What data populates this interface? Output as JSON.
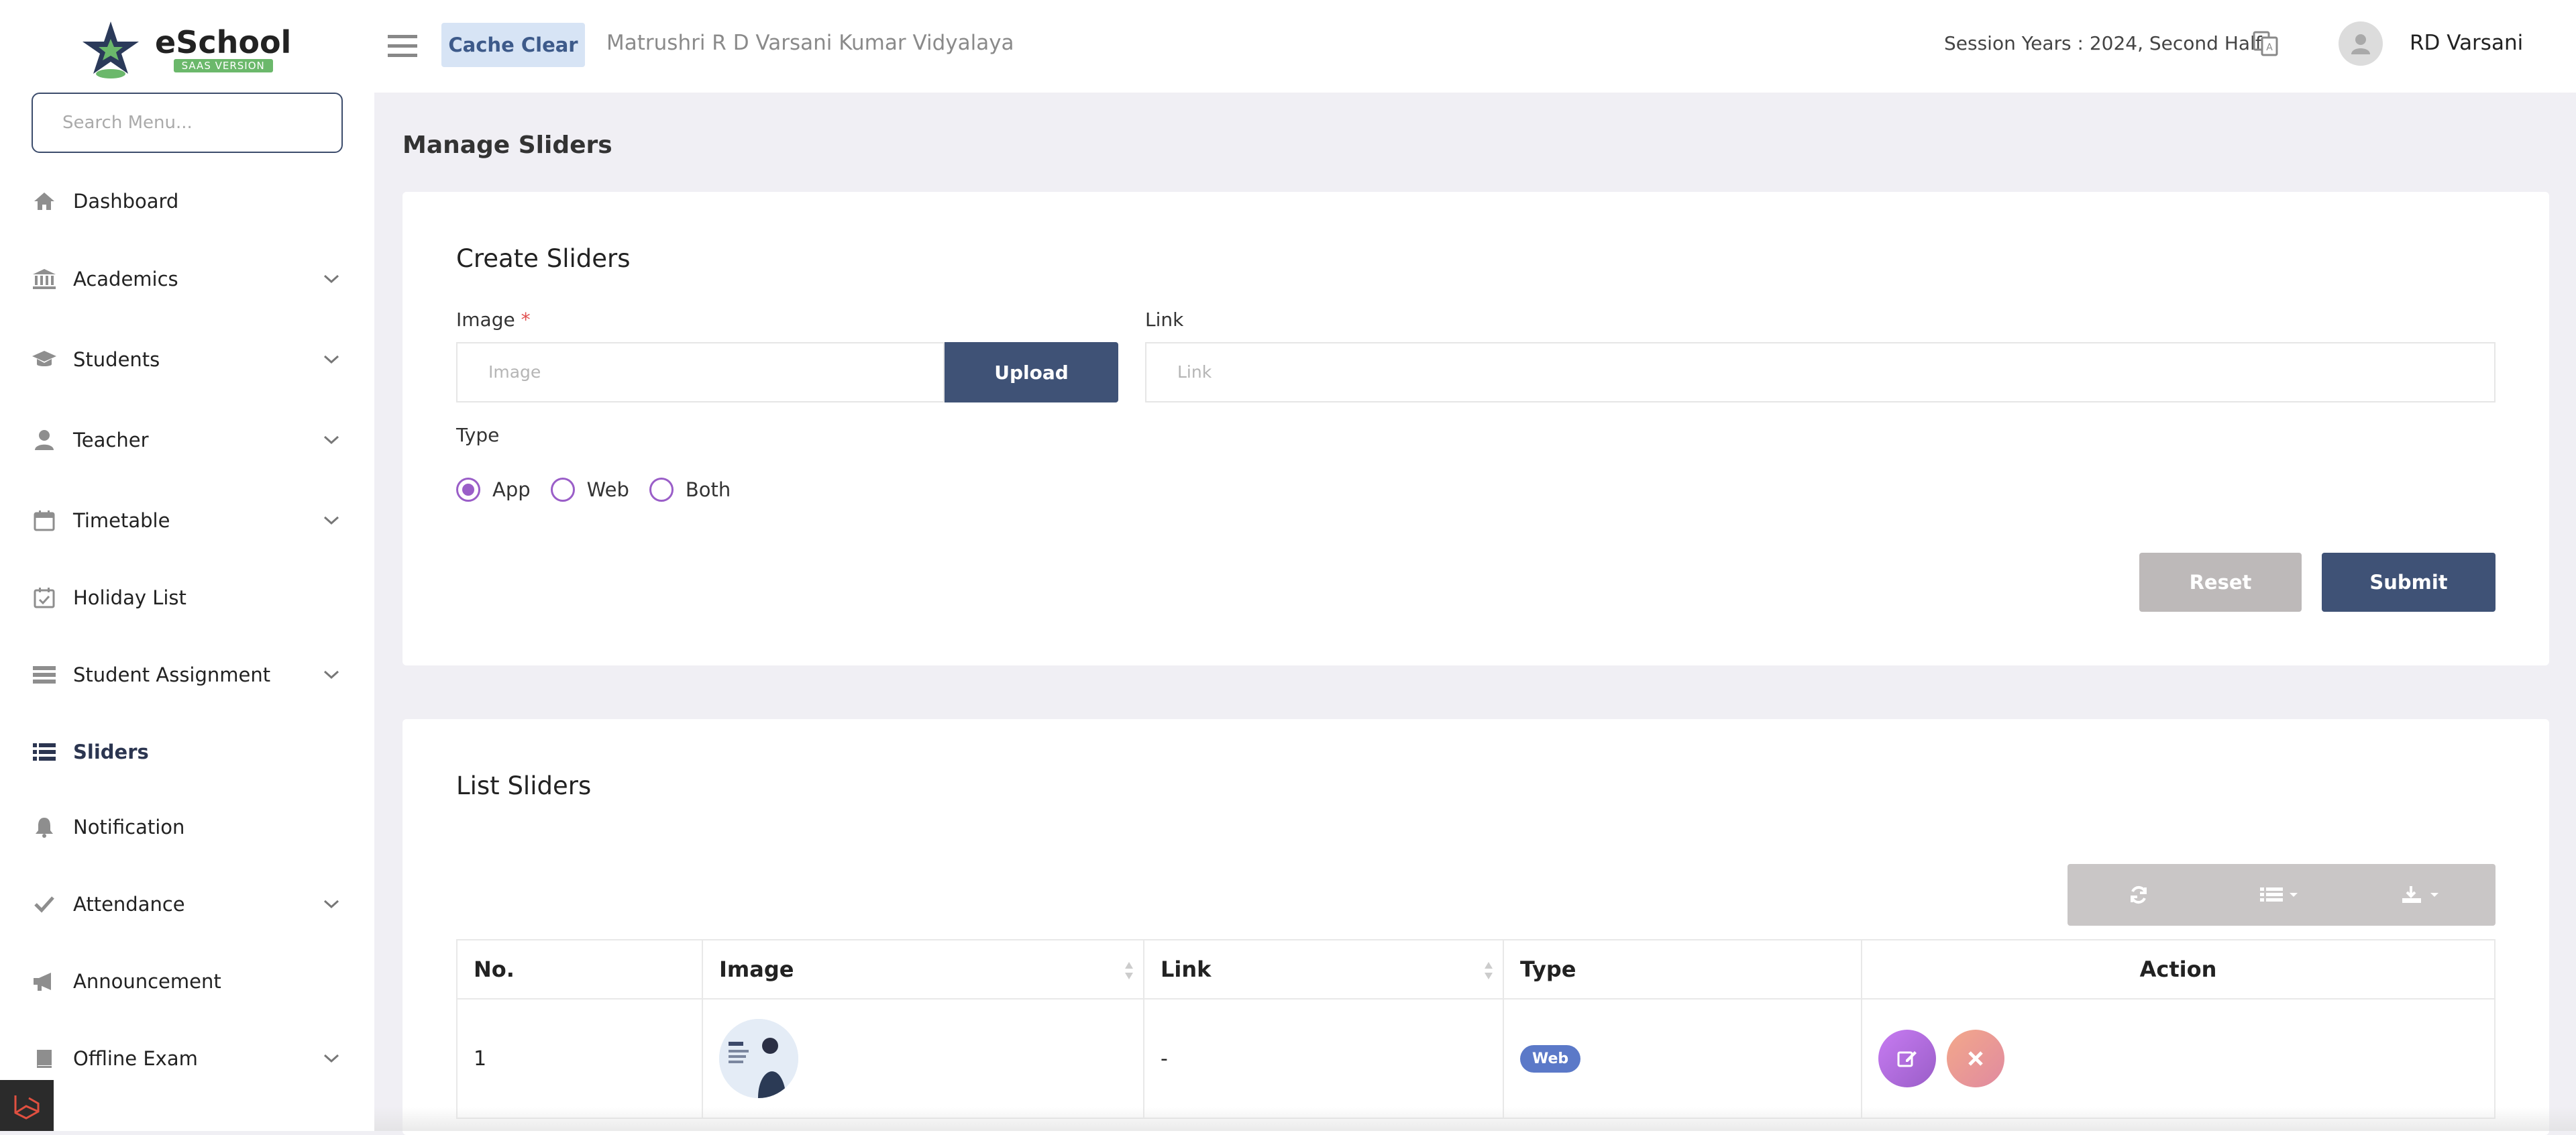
{
  "brand": {
    "name": "eSchool",
    "badge": "SAAS VERSION"
  },
  "search": {
    "placeholder": "Search Menu..."
  },
  "sidebar": {
    "items": [
      {
        "label": "Dashboard",
        "icon": "home-icon",
        "expandable": false
      },
      {
        "label": "Academics",
        "icon": "bank-icon",
        "expandable": true
      },
      {
        "label": "Students",
        "icon": "graduation-cap-icon",
        "expandable": true
      },
      {
        "label": "Teacher",
        "icon": "user-icon",
        "expandable": true
      },
      {
        "label": "Timetable",
        "icon": "calendar-icon",
        "expandable": true
      },
      {
        "label": "Holiday List",
        "icon": "calendar-check-icon",
        "expandable": false
      },
      {
        "label": "Student Assignment",
        "icon": "tasks-icon",
        "expandable": true
      },
      {
        "label": "Sliders",
        "icon": "list-icon",
        "expandable": false,
        "active": true
      },
      {
        "label": "Notification",
        "icon": "bell-icon",
        "expandable": false
      },
      {
        "label": "Attendance",
        "icon": "check-icon",
        "expandable": true
      },
      {
        "label": "Announcement",
        "icon": "bullhorn-icon",
        "expandable": false
      },
      {
        "label": "Offline Exam",
        "icon": "book-icon",
        "expandable": true
      }
    ]
  },
  "header": {
    "cache_clear": "Cache Clear",
    "school_name": "Matrushri R D Varsani Kumar Vidyalaya",
    "session": "Session Years : 2024, Second Half",
    "user_name": "RD Varsani"
  },
  "page": {
    "title": "Manage Sliders"
  },
  "create": {
    "title": "Create Sliders",
    "image_label": "Image",
    "required_mark": "*",
    "image_placeholder": "Image",
    "upload_label": "Upload",
    "link_label": "Link",
    "link_placeholder": "Link",
    "type_label": "Type",
    "types": [
      "App",
      "Web",
      "Both"
    ],
    "selected_type": "App",
    "reset_label": "Reset",
    "submit_label": "Submit"
  },
  "list": {
    "title": "List Sliders",
    "columns": [
      "No.",
      "Image",
      "Link",
      "Type",
      "Action"
    ],
    "rows": [
      {
        "no": "1",
        "link": "-",
        "type": "Web"
      }
    ]
  },
  "colors": {
    "primary": "#3f5276",
    "accent": "#9a5ec8",
    "reset": "#bdb9b9",
    "badge_web": "#5b79c8"
  }
}
